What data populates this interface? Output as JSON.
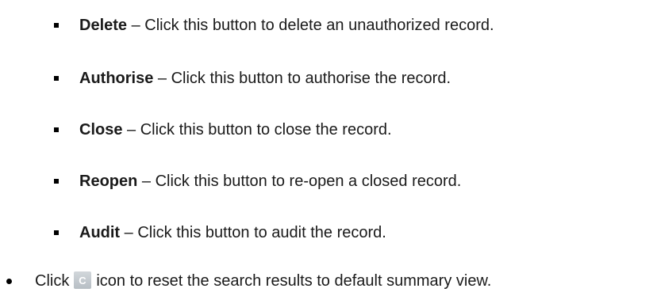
{
  "action_list": {
    "items": [
      {
        "term": "Delete",
        "sep": " – ",
        "desc": "Click this button to delete an unauthorized record."
      },
      {
        "term": "Authorise",
        "sep": " – ",
        "desc": "Click this button to authorise the record."
      },
      {
        "term": "Close",
        "sep": " – ",
        "desc": "Click this button to close the record."
      },
      {
        "term": "Reopen",
        "sep": " – ",
        "desc": "Click this button to re-open a closed record."
      },
      {
        "term": "Audit",
        "sep": " – ",
        "desc": "Click this button to audit the record."
      }
    ]
  },
  "reset_note": {
    "before": "Click",
    "icon": "reset-icon",
    "icon_letter": "C",
    "after": "icon to reset the search results to default summary view."
  },
  "colors": {
    "text": "#1a1a1a",
    "icon_bg": "#c5cbd0",
    "icon_glyph": "#ffffff"
  }
}
